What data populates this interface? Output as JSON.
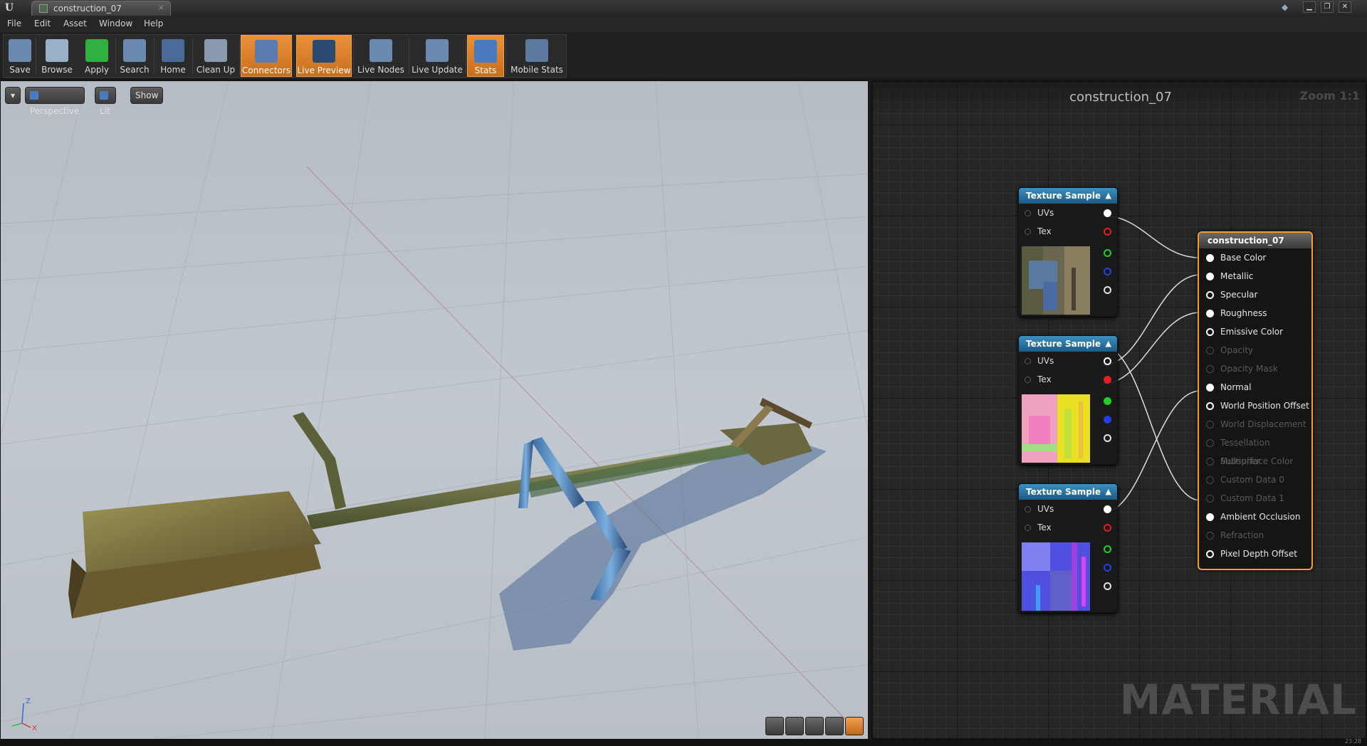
{
  "window": {
    "tab_title": "construction_07",
    "tab_close": "×",
    "logo": "U",
    "controls": [
      "▁",
      "❐",
      "✕"
    ]
  },
  "menu": [
    "File",
    "Edit",
    "Asset",
    "Window",
    "Help"
  ],
  "toolbar": {
    "buttons": [
      {
        "label": "Save",
        "icon": "save-icon",
        "active": false
      },
      {
        "label": "Browse",
        "icon": "browse-icon",
        "active": false
      },
      {
        "label": "Apply",
        "icon": "apply-icon",
        "active": false
      },
      {
        "label": "Search",
        "icon": "search-icon",
        "active": false
      },
      {
        "label": "Home",
        "icon": "home-icon",
        "active": false
      },
      {
        "label": "Clean Up",
        "icon": "clean-up-icon",
        "active": false
      },
      {
        "label": "Connectors",
        "icon": "connectors-icon",
        "active": true
      },
      {
        "label": "Live Preview",
        "icon": "live-preview-icon",
        "active": true
      },
      {
        "label": "Live Nodes",
        "icon": "live-nodes-icon",
        "active": false
      },
      {
        "label": "Live Update",
        "icon": "live-update-icon",
        "active": false
      },
      {
        "label": "Stats",
        "icon": "stats-icon",
        "active": true
      },
      {
        "label": "Mobile Stats",
        "icon": "mobile-stats-icon",
        "active": false
      }
    ]
  },
  "viewport": {
    "dropdown": "▾",
    "perspective": "Perspective",
    "lit": "Lit",
    "show": "Show",
    "axis": {
      "z": "Z",
      "x": "X"
    }
  },
  "graph": {
    "title": "construction_07",
    "zoom": "Zoom 1:1",
    "watermark": "MATERIAL",
    "texture_nodes": [
      {
        "title": "Texture Sample",
        "collapse": "▲",
        "uvs": "UVs",
        "tex": "Tex",
        "thumb": "diffuse"
      },
      {
        "title": "Texture Sample",
        "collapse": "▲",
        "uvs": "UVs",
        "tex": "Tex",
        "thumb": "roughness"
      },
      {
        "title": "Texture Sample",
        "collapse": "▲",
        "uvs": "UVs",
        "tex": "Tex",
        "thumb": "normal"
      }
    ],
    "material_node": {
      "title": "construction_07",
      "pins": [
        {
          "label": "Base Color",
          "enabled": true,
          "connected": true
        },
        {
          "label": "Metallic",
          "enabled": true,
          "connected": true
        },
        {
          "label": "Specular",
          "enabled": true,
          "connected": false
        },
        {
          "label": "Roughness",
          "enabled": true,
          "connected": true
        },
        {
          "label": "Emissive Color",
          "enabled": true,
          "connected": false
        },
        {
          "label": "Opacity",
          "enabled": false,
          "connected": false
        },
        {
          "label": "Opacity Mask",
          "enabled": false,
          "connected": false
        },
        {
          "label": "Normal",
          "enabled": true,
          "connected": true
        },
        {
          "label": "World Position Offset",
          "enabled": true,
          "connected": false
        },
        {
          "label": "World Displacement",
          "enabled": false,
          "connected": false
        },
        {
          "label": "Tessellation Multiplier",
          "enabled": false,
          "connected": false
        },
        {
          "label": "Subsurface Color",
          "enabled": false,
          "connected": false
        },
        {
          "label": "Custom Data 0",
          "enabled": false,
          "connected": false
        },
        {
          "label": "Custom Data 1",
          "enabled": false,
          "connected": false
        },
        {
          "label": "Ambient Occlusion",
          "enabled": true,
          "connected": true
        },
        {
          "label": "Refraction",
          "enabled": false,
          "connected": false
        },
        {
          "label": "Pixel Depth Offset",
          "enabled": true,
          "connected": false
        }
      ]
    }
  },
  "status": {
    "time": "23:28"
  }
}
